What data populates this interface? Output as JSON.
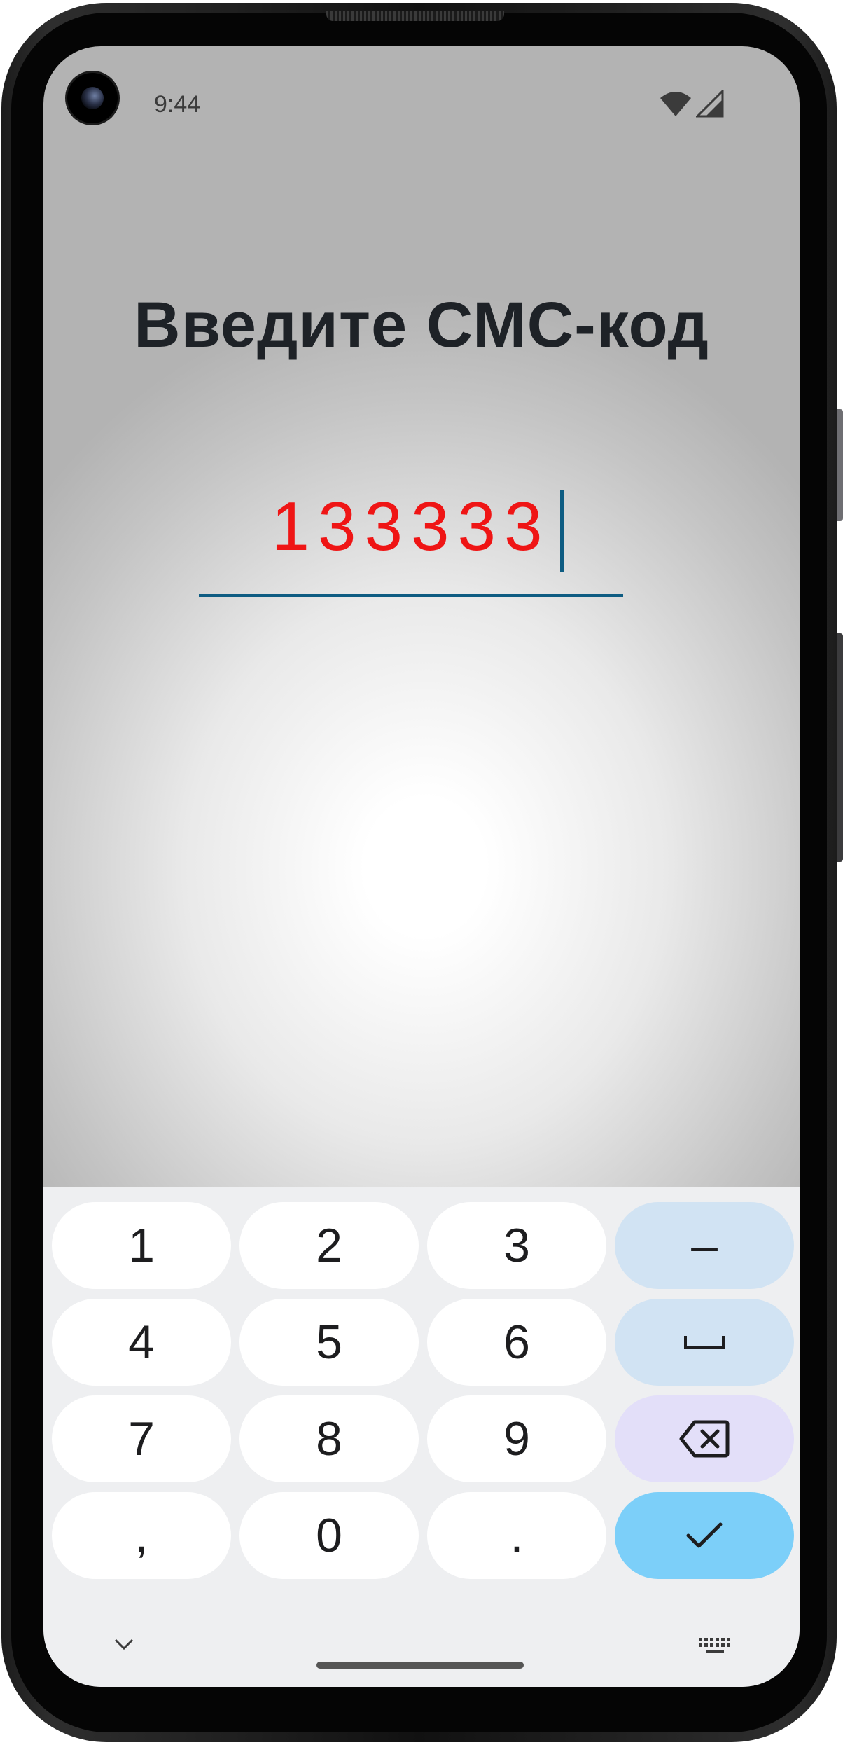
{
  "status_bar": {
    "time": "9:44",
    "icons": [
      "wifi-icon",
      "cell-signal-icon"
    ]
  },
  "screen": {
    "title": "Введите СМС-код",
    "code_value": "133333",
    "code_color": "#ef1515",
    "accent_color": "#0e5c82"
  },
  "keyboard": {
    "keys": [
      [
        "1",
        "2",
        "3",
        "–"
      ],
      [
        "4",
        "5",
        "6",
        "␣"
      ],
      [
        "7",
        "8",
        "9",
        "⌫"
      ],
      [
        ",",
        "0",
        ".",
        "✓"
      ]
    ],
    "icons": {
      "space": "space-bar-icon",
      "backspace": "backspace-icon",
      "done": "checkmark-icon",
      "hide": "chevron-down-icon",
      "switch": "keyboard-icon"
    }
  }
}
